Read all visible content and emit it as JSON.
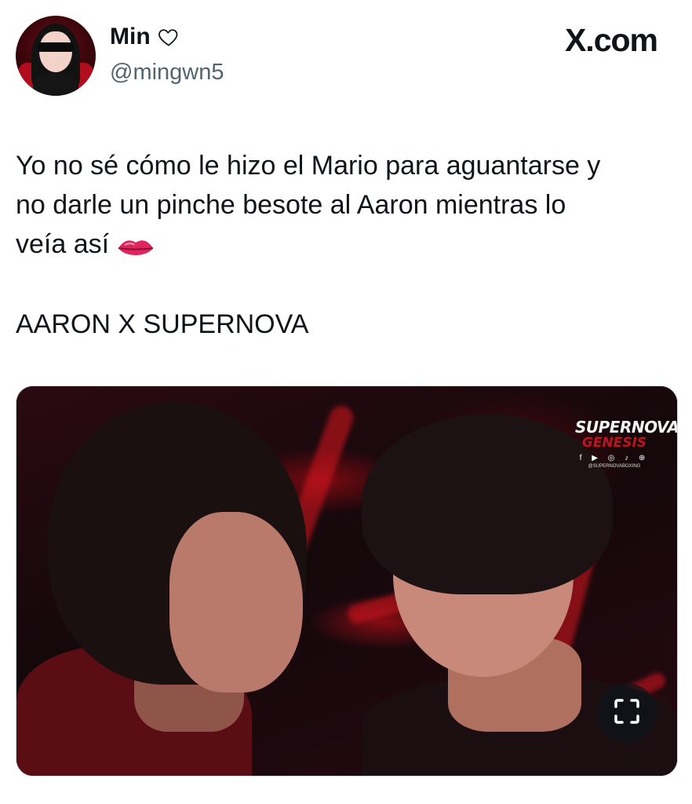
{
  "author": {
    "display_name": "Min",
    "handle": "@mingwn5"
  },
  "brand": "X.com",
  "tweet": {
    "text_line1": "Yo no sé cómo le hizo el Mario para aguantarse y",
    "text_line2": "no darle un pinche besote al Aaron mientras lo",
    "text_line3": "veía así",
    "tag": "AARON X SUPERNOVA"
  },
  "media": {
    "watermark_title": "SUPERNOVA",
    "watermark_subtitle": "GENESIS",
    "watermark_handle": "@SUPERNOVABOXING",
    "watermark_icons": "f ▶ ◎ ♪ ⊕"
  },
  "icons": {
    "heart": "heart-outline-icon",
    "lips": "lips-emoji-icon",
    "expand": "expand-fullscreen-icon"
  },
  "colors": {
    "text": "#0f1419",
    "secondary": "#536471",
    "accent_red": "#c1121f"
  }
}
